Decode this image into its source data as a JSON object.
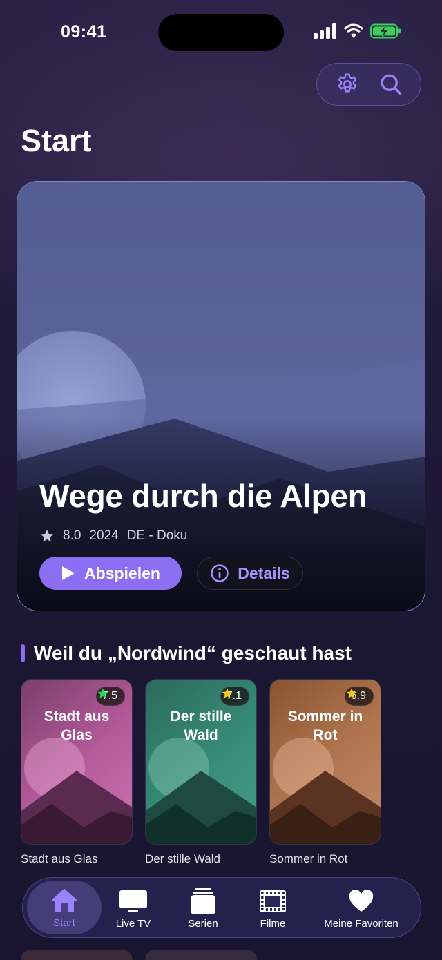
{
  "status_bar": {
    "time": "09:41"
  },
  "header": {
    "title": "Start",
    "settings_icon": "gear-icon",
    "search_icon": "search-icon"
  },
  "hero": {
    "title": "Wege durch die Alpen",
    "rating": "8.0",
    "year": "2024",
    "genre": "DE - Doku",
    "play_label": "Abspielen",
    "details_label": "Details"
  },
  "section": {
    "title": "Weil du „Nordwind“ geschaut hast",
    "items": [
      {
        "title_on_poster": "Stadt aus Glas",
        "rating": "7.5",
        "caption": "Stadt aus Glas",
        "star_color": "#2fd35a"
      },
      {
        "title_on_poster": "Der stille Wald",
        "rating": "7.1",
        "caption": "Der stille Wald",
        "star_color": "#f7c71b"
      },
      {
        "title_on_poster": "Sommer in Rot",
        "rating": "6.9",
        "caption": "Sommer in Rot",
        "star_color": "#f7c71b"
      }
    ]
  },
  "tabbar": {
    "tabs": [
      {
        "label": "Start",
        "icon": "home-icon",
        "active": true
      },
      {
        "label": "Live TV",
        "icon": "tv-icon",
        "active": false
      },
      {
        "label": "Serien",
        "icon": "stack-icon",
        "active": false
      },
      {
        "label": "Filme",
        "icon": "film-icon",
        "active": false
      },
      {
        "label": "Meine Favoriten",
        "icon": "heart-icon",
        "active": false
      }
    ]
  },
  "colors": {
    "accent": "#8b6ef2",
    "background": "#1c1733"
  }
}
